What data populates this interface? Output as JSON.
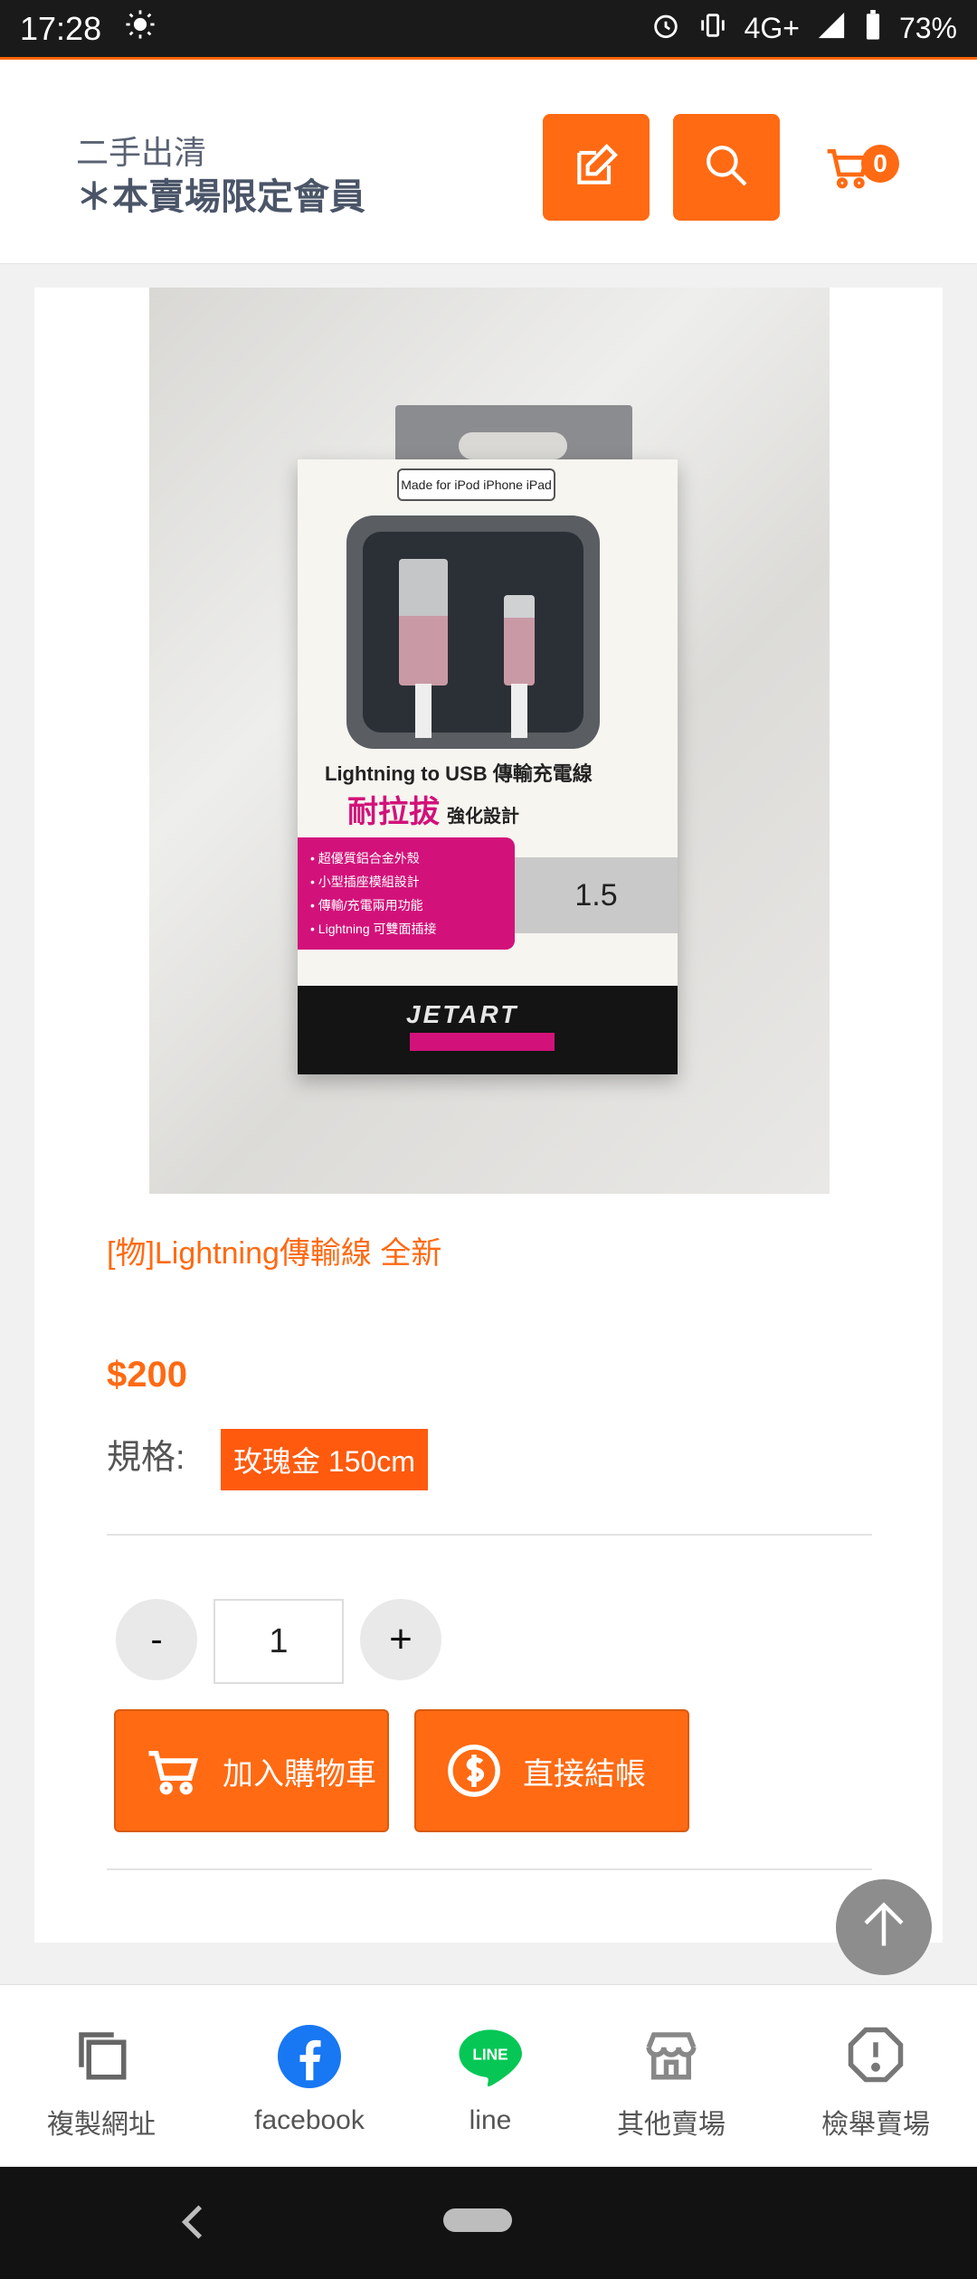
{
  "status_bar": {
    "time": "17:28",
    "network": "4G+",
    "battery": "73%"
  },
  "header": {
    "subtitle": "二手出清",
    "title": "＊本賣場限定會員",
    "cart_count": "0"
  },
  "product": {
    "title": "[物]Lightning傳輸線 全新",
    "price": "$200",
    "spec_label": "規格:",
    "spec_value": "玫瑰金 150cm",
    "quantity": "1",
    "minus_label": "-",
    "plus_label": "+",
    "add_to_cart_label": "加入購物車",
    "checkout_label": "直接結帳",
    "image_text": {
      "made_for": "Made for iPod iPhone iPad",
      "line1": "Lightning to USB 傳輸充電線",
      "line2": "耐拉拔",
      "line2b": "強化設計",
      "features": [
        "超優質鋁合金外殼",
        "小型插座模組設計",
        "傳輸/充電兩用功能",
        "Lightning 可雙面插接"
      ],
      "length": "1.5",
      "brand": "JETART"
    }
  },
  "tabs": [
    {
      "label": "複製網址",
      "icon": "copy-icon"
    },
    {
      "label": "facebook",
      "icon": "facebook-icon"
    },
    {
      "label": "line",
      "icon": "line-icon"
    },
    {
      "label": "其他賣場",
      "icon": "store-icon"
    },
    {
      "label": "檢舉賣場",
      "icon": "report-icon"
    }
  ],
  "colors": {
    "accent": "#ff6a13",
    "facebook": "#1877f2",
    "line": "#06c755"
  }
}
